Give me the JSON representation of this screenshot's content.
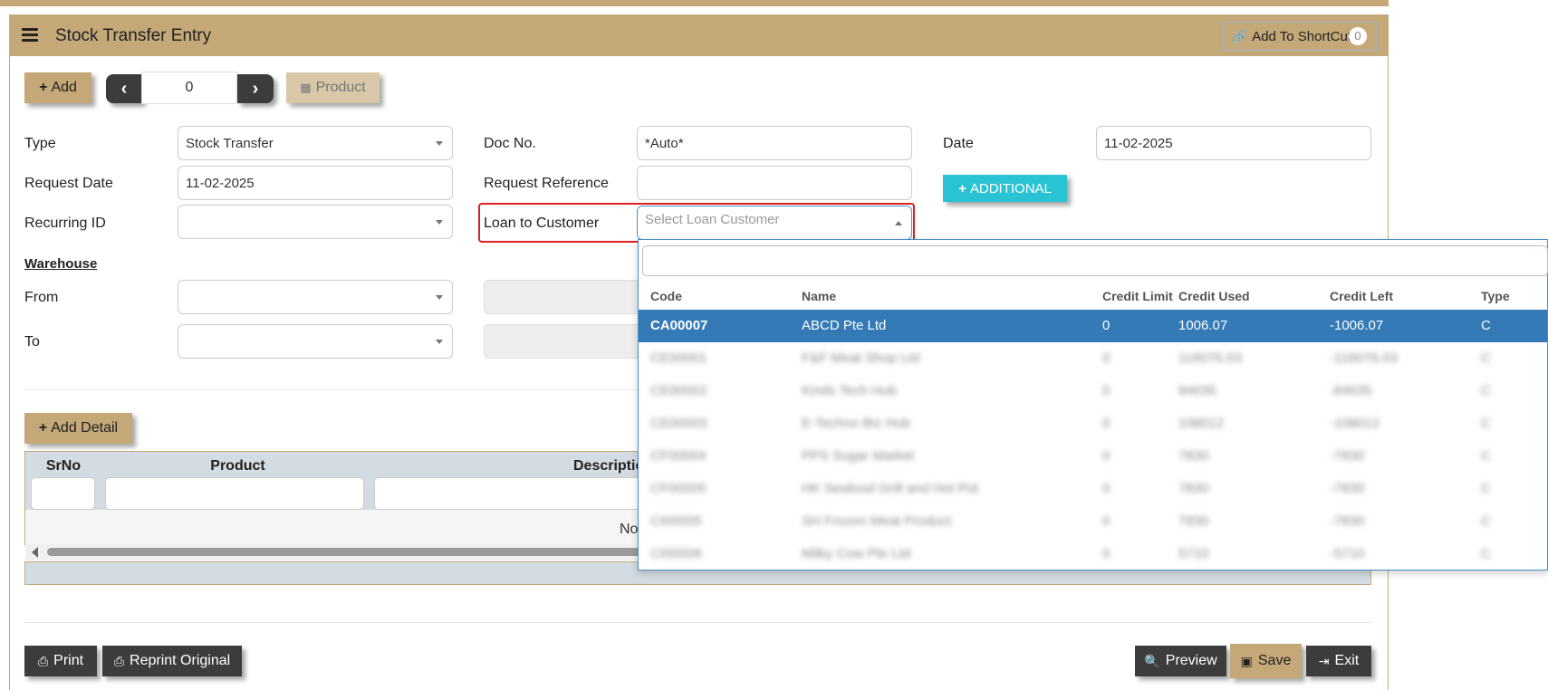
{
  "header": {
    "title": "Stock Transfer Entry",
    "shortcut_label": "Add To ShortCut",
    "shortcut_count": "0"
  },
  "toolbar": {
    "add_label": "Add",
    "pager_value": "0",
    "product_label": "Product"
  },
  "form": {
    "type_label": "Type",
    "type_value": "Stock Transfer",
    "docno_label": "Doc No.",
    "docno_value": "*Auto*",
    "date_label": "Date",
    "date_value": "11-02-2025",
    "request_date_label": "Request Date",
    "request_date_value": "11-02-2025",
    "request_ref_label": "Request Reference",
    "request_ref_value": "",
    "additional_label": "ADDITIONAL",
    "recurring_label": "Recurring ID",
    "recurring_value": "",
    "loan_label": "Loan to Customer",
    "loan_placeholder": "Select Loan Customer",
    "warehouse_heading": "Warehouse",
    "from_label": "From",
    "to_label": "To"
  },
  "detail": {
    "add_detail_label": "Add Detail",
    "columns": [
      "SrNo",
      "Product",
      "Description"
    ],
    "empty_message": "No"
  },
  "footer": {
    "print_label": "Print",
    "reprint_label": "Reprint Original",
    "preview_label": "Preview",
    "save_label": "Save",
    "exit_label": "Exit"
  },
  "dropdown": {
    "search_value": "",
    "columns": [
      "Code",
      "Name",
      "Credit Limit",
      "Credit Used",
      "Credit Left",
      "Type"
    ],
    "rows": [
      {
        "code": "CA00007",
        "name": "ABCD Pte Ltd",
        "limit": "0",
        "used": "1006.07",
        "left": "-1006.07",
        "type": "C",
        "selected": true
      },
      {
        "code": "CE00001",
        "name": "F&F Meat Shop Ltd",
        "limit": "0",
        "used": "116076.03",
        "left": "-116076.03",
        "type": "C"
      },
      {
        "code": "CE00002",
        "name": "Kinds Tech Hub",
        "limit": "0",
        "used": "84635",
        "left": "-84635",
        "type": "C"
      },
      {
        "code": "CE00003",
        "name": "E-Techno Biz Hub",
        "limit": "0",
        "used": "108012",
        "left": "-108012",
        "type": "C"
      },
      {
        "code": "CF00004",
        "name": "PPS Sugar Market",
        "limit": "0",
        "used": "7830",
        "left": "-7830",
        "type": "C"
      },
      {
        "code": "CF00005",
        "name": "HK Seafood Grill and Hot Pot",
        "limit": "0",
        "used": "7830",
        "left": "-7830",
        "type": "C"
      },
      {
        "code": "CI00005",
        "name": "SH Frozen Meat Product",
        "limit": "0",
        "used": "7830",
        "left": "-7830",
        "type": "C"
      },
      {
        "code": "CI00006",
        "name": "Milky Cow Pte Ltd",
        "limit": "0",
        "used": "5710",
        "left": "-5710",
        "type": "C"
      }
    ]
  }
}
